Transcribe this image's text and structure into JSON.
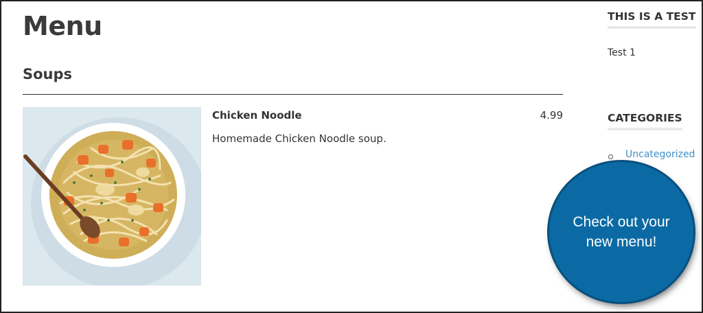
{
  "page": {
    "title": "Menu"
  },
  "section": {
    "title": "Soups"
  },
  "item": {
    "name": "Chicken Noodle",
    "price": "4.99",
    "description": "Homemade Chicken Noodle soup.",
    "image": "chicken-noodle-soup-photo"
  },
  "sidebar": {
    "test_widget": {
      "title": "THIS IS A TEST",
      "text": "Test 1"
    },
    "categories_widget": {
      "title": "CATEGORIES",
      "items": [
        {
          "label": "Uncategorized"
        }
      ]
    }
  },
  "callout": {
    "text": "Check out your new menu!"
  },
  "colors": {
    "link": "#3d8fc9",
    "callout": "#0b6aa4",
    "text": "#333333"
  }
}
